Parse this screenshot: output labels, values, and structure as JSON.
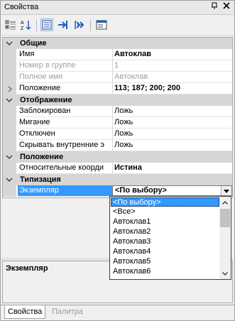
{
  "window": {
    "title": "Свойства",
    "pin_icon": "pin-icon",
    "close_icon": "close-icon"
  },
  "toolbar": {
    "buttons": [
      {
        "name": "categorized-view-button",
        "icon": "categorized-icon",
        "pressed": false
      },
      {
        "name": "alphabetical-sort-button",
        "icon": "sort-az-icon",
        "pressed": false
      },
      {
        "name": "properties-button",
        "icon": "properties-list-icon",
        "pressed": true
      },
      {
        "name": "events-button",
        "icon": "arrow-right-icon",
        "pressed": false
      },
      {
        "name": "actions-button",
        "icon": "double-arrow-icon",
        "pressed": false
      },
      {
        "name": "property-pages-button",
        "icon": "property-pages-icon",
        "pressed": false
      }
    ]
  },
  "grid": {
    "general": {
      "label": "Общие",
      "rows": [
        {
          "name": "Имя",
          "value": "Автоклав"
        },
        {
          "name": "Номер в группе",
          "value": "1"
        },
        {
          "name": "Полное имя",
          "value": "Автоклав"
        },
        {
          "name": "Положение",
          "value": "113; 187; 200; 200"
        }
      ]
    },
    "display": {
      "label": "Отображение",
      "rows": [
        {
          "name": "Заблокирован",
          "value": "Ложь"
        },
        {
          "name": "Мигание",
          "value": "Ложь"
        },
        {
          "name": "Отключен",
          "value": "Ложь"
        },
        {
          "name": "Скрывать внутренние э",
          "value": "Ложь"
        }
      ]
    },
    "position": {
      "label": "Положение",
      "rows": [
        {
          "name": "Относительные коорди",
          "value": "Истина"
        }
      ]
    },
    "typing": {
      "label": "Типизация",
      "rows": [
        {
          "name": "Экземпляр",
          "value": "<По выбору>"
        }
      ]
    }
  },
  "dropdown": {
    "options": [
      "<По выбору>",
      "<Все>",
      "Автоклав1",
      "Автоклав2",
      "Автоклав3",
      "Автоклав4",
      "Автоклав5",
      "Автоклав6"
    ],
    "selected": "<По выбору>"
  },
  "description": {
    "title": "Экземпляр"
  },
  "tabs": [
    {
      "label": "Свойства",
      "active": true
    },
    {
      "label": "Палитра",
      "active": false
    }
  ]
}
